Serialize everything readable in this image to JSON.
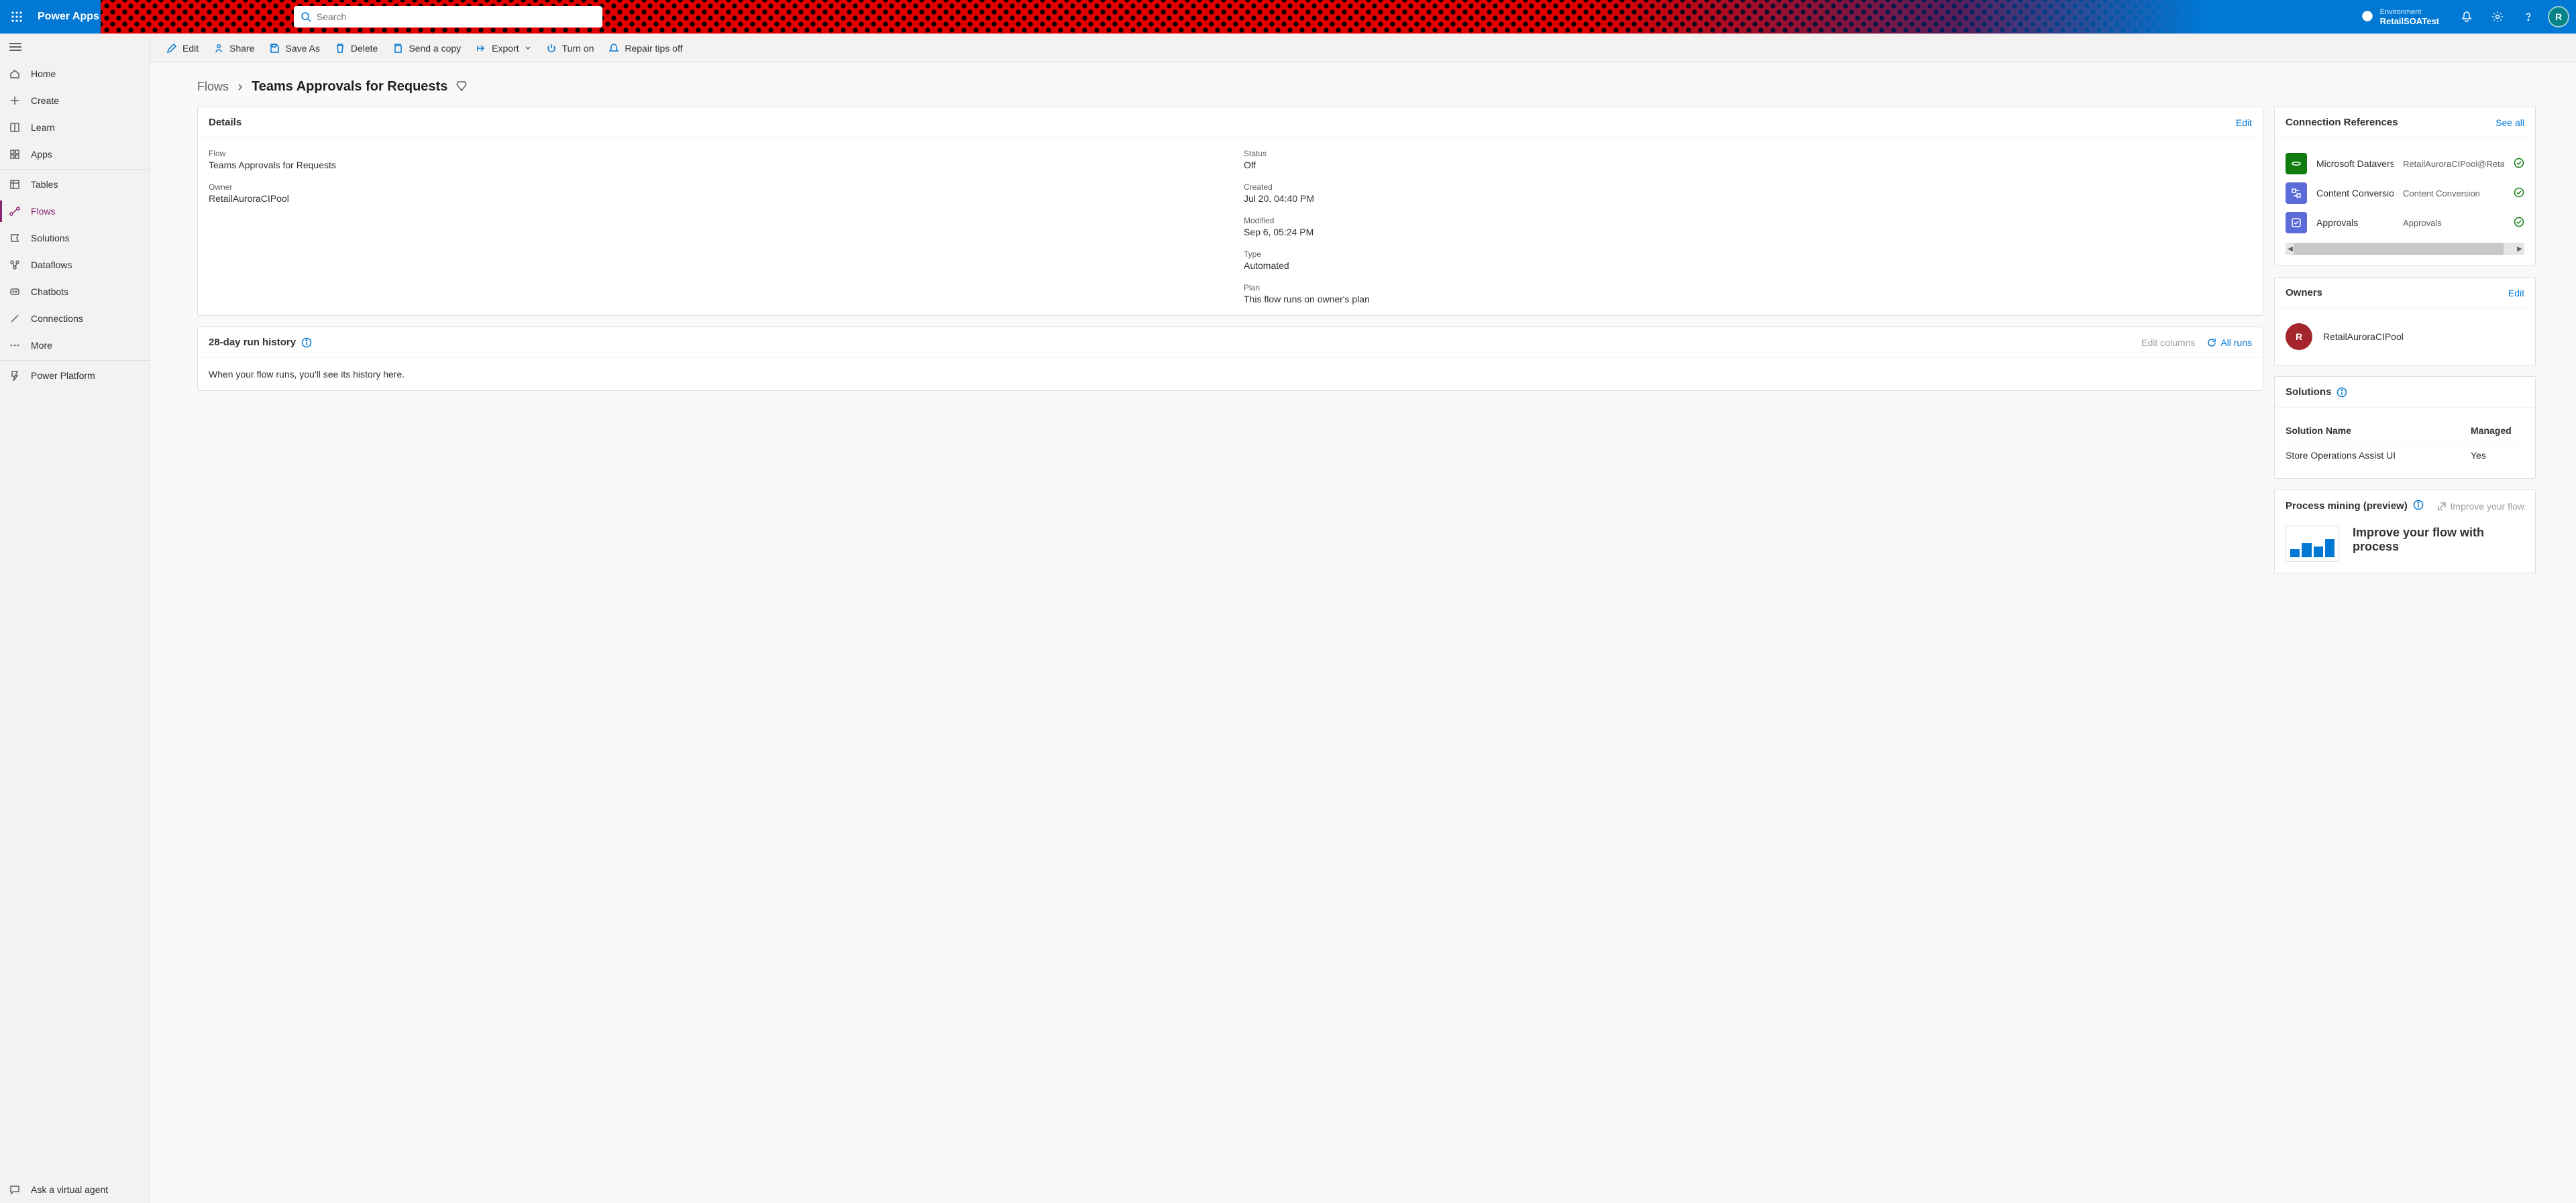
{
  "header": {
    "brand": "Power Apps",
    "search_placeholder": "Search",
    "env_label": "Environment",
    "env_name": "RetailSOATest",
    "avatar_initial": "R"
  },
  "leftnav": {
    "items_top": [
      {
        "label": "Home",
        "icon": "home"
      },
      {
        "label": "Create",
        "icon": "plus"
      },
      {
        "label": "Learn",
        "icon": "book"
      },
      {
        "label": "Apps",
        "icon": "grid"
      }
    ],
    "items_mid": [
      {
        "label": "Tables",
        "icon": "table"
      },
      {
        "label": "Flows",
        "icon": "flow",
        "selected": true
      },
      {
        "label": "Solutions",
        "icon": "solution"
      },
      {
        "label": "Dataflows",
        "icon": "dataflow"
      },
      {
        "label": "Chatbots",
        "icon": "chatbot"
      },
      {
        "label": "Connections",
        "icon": "connection"
      },
      {
        "label": "More",
        "icon": "more"
      }
    ],
    "power_platform": "Power Platform",
    "ask_agent": "Ask a virtual agent"
  },
  "commandbar": {
    "edit": "Edit",
    "share": "Share",
    "save_as": "Save As",
    "delete": "Delete",
    "send_copy": "Send a copy",
    "export": "Export",
    "turn_on": "Turn on",
    "repair": "Repair tips off"
  },
  "breadcrumb": {
    "root": "Flows",
    "current": "Teams Approvals for Requests"
  },
  "details": {
    "title": "Details",
    "edit_link": "Edit",
    "flow_label": "Flow",
    "flow_value": "Teams Approvals for Requests",
    "owner_label": "Owner",
    "owner_value": "RetailAuroraCIPool",
    "status_label": "Status",
    "status_value": "Off",
    "created_label": "Created",
    "created_value": "Jul 20, 04:40 PM",
    "modified_label": "Modified",
    "modified_value": "Sep 6, 05:24 PM",
    "type_label": "Type",
    "type_value": "Automated",
    "plan_label": "Plan",
    "plan_value": "This flow runs on owner's plan"
  },
  "history": {
    "title": "28-day run history",
    "edit_cols": "Edit columns",
    "all_runs": "All runs",
    "empty": "When your flow runs, you'll see its history here."
  },
  "connections": {
    "title": "Connection References",
    "see_all": "See all",
    "rows": [
      {
        "name": "Microsoft Dataverse",
        "sub": "RetailAuroraCIPool@RetailCPO",
        "color": "green"
      },
      {
        "name": "Content Conversion",
        "sub": "Content Conversion",
        "color": "blue"
      },
      {
        "name": "Approvals",
        "sub": "Approvals",
        "color": "blue"
      }
    ]
  },
  "owners": {
    "title": "Owners",
    "edit": "Edit",
    "rows": [
      {
        "initial": "R",
        "name": "RetailAuroraCIPool"
      }
    ]
  },
  "solutions": {
    "title": "Solutions",
    "col_name": "Solution Name",
    "col_managed": "Managed",
    "rows": [
      {
        "name": "Store Operations Assist UI",
        "managed": "Yes"
      }
    ]
  },
  "process_mining": {
    "title": "Process mining (preview)",
    "improve_link": "Improve your flow",
    "headline": "Improve your flow with process"
  }
}
